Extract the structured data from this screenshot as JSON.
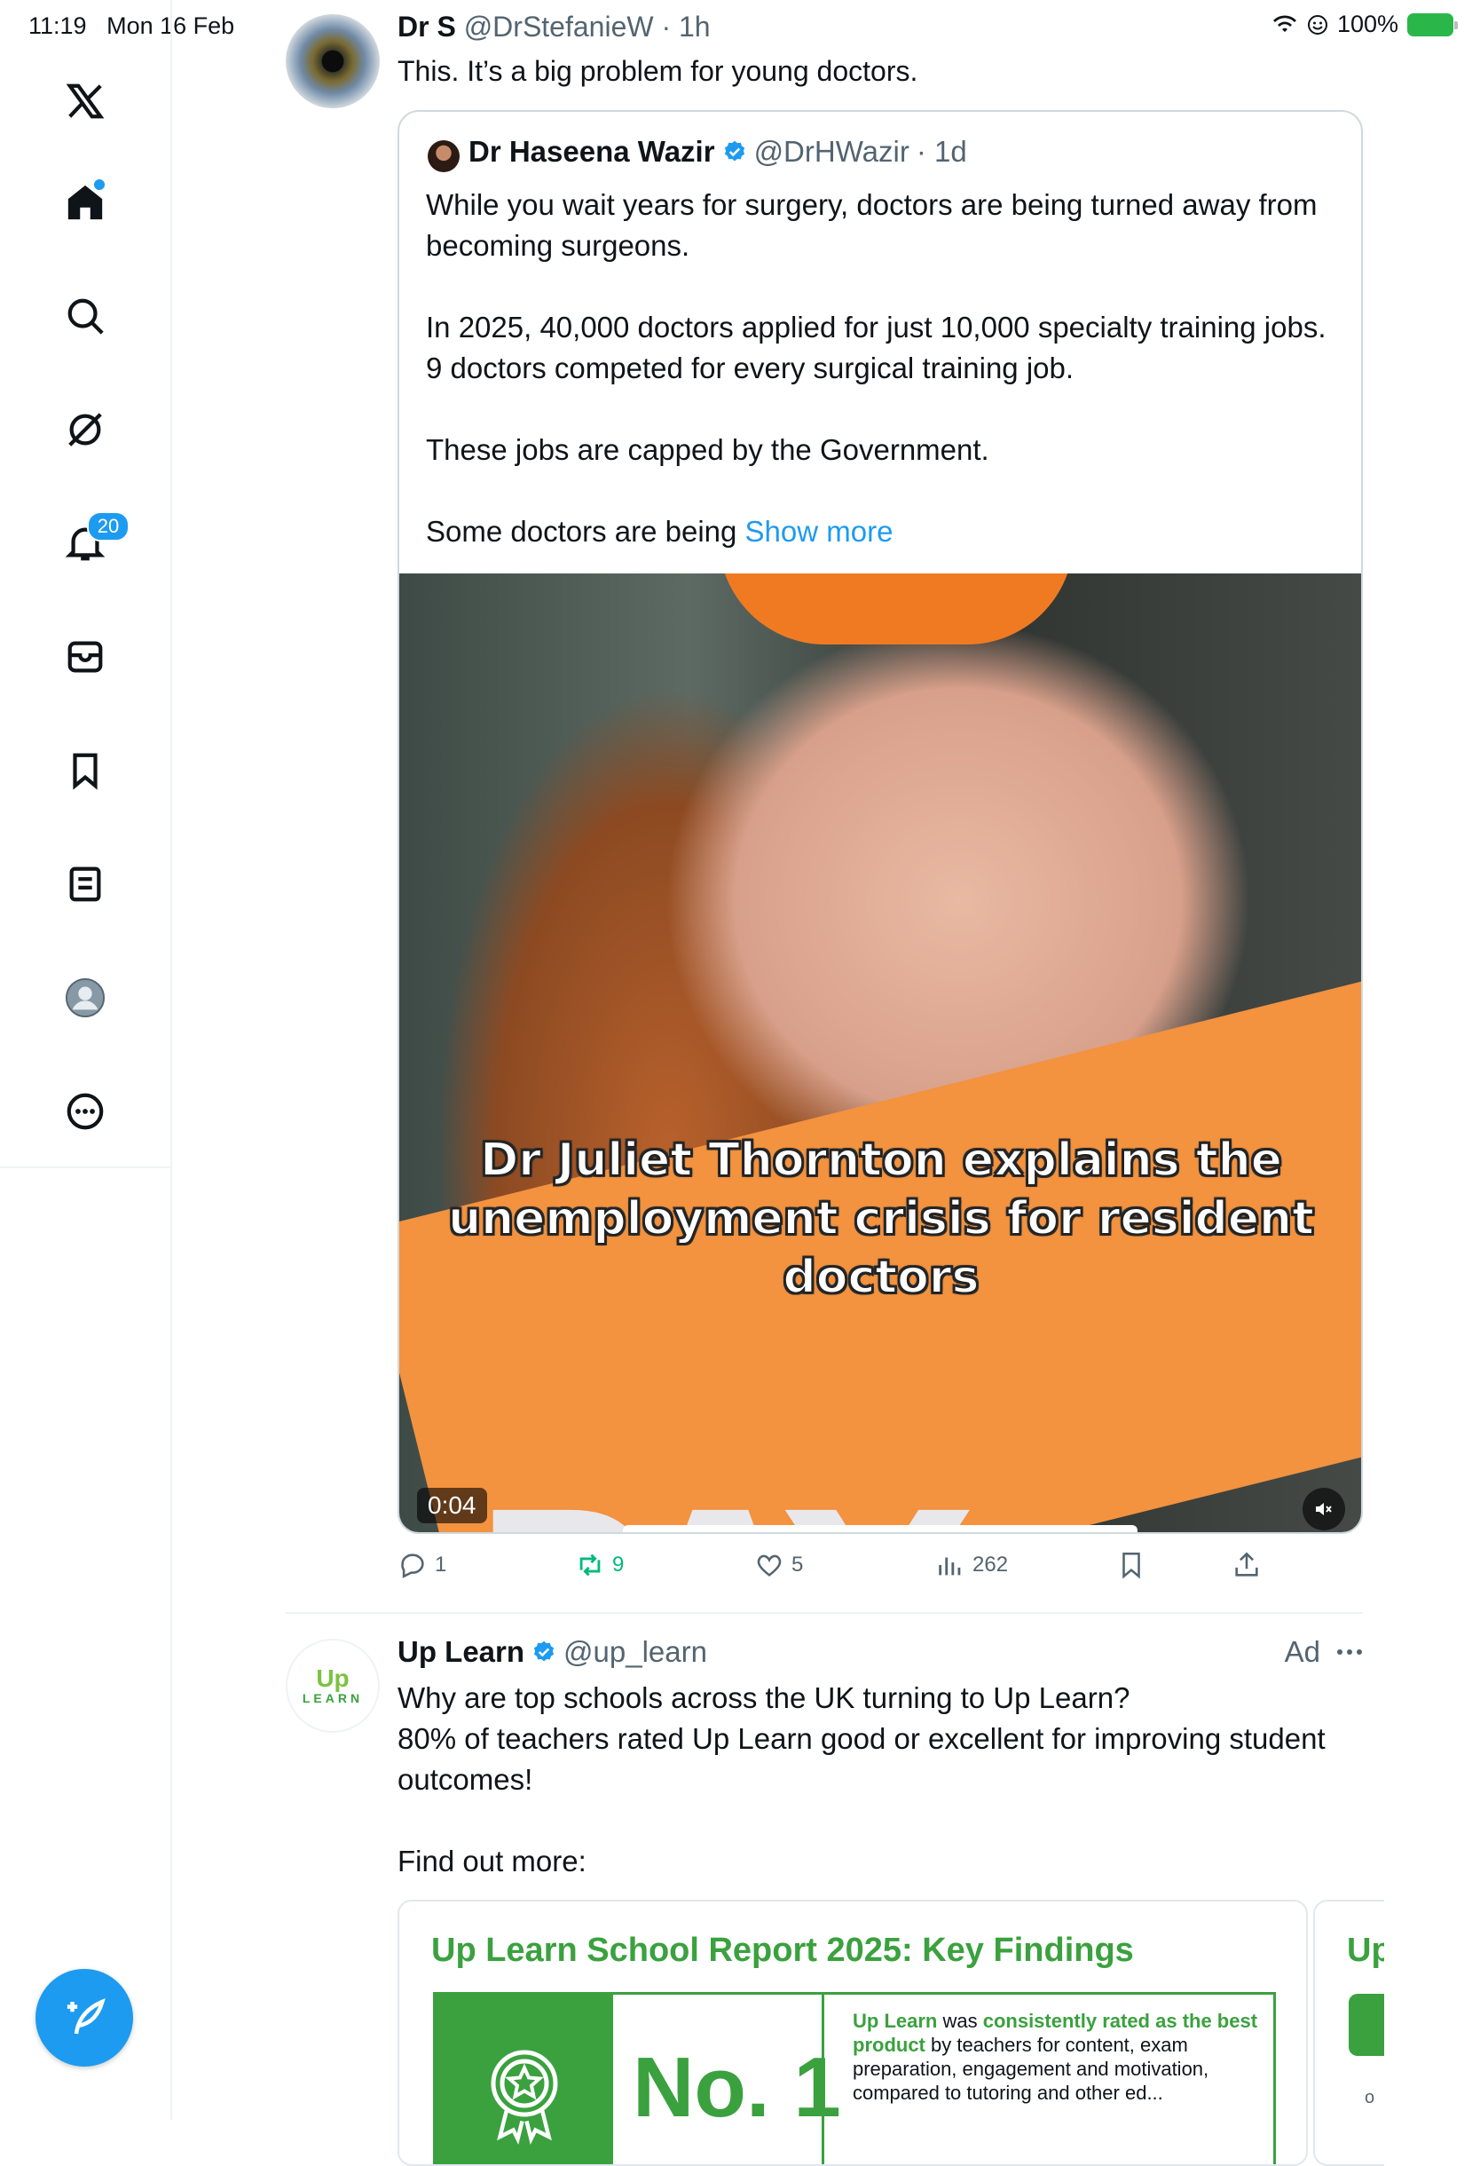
{
  "status_bar": {
    "time": "11:19",
    "date": "Mon 16 Feb",
    "battery": "100%"
  },
  "sidebar": {
    "items": [
      {
        "name": "x-logo"
      },
      {
        "name": "home"
      },
      {
        "name": "search"
      },
      {
        "name": "grok"
      },
      {
        "name": "notifications",
        "badge": "20"
      },
      {
        "name": "messages"
      },
      {
        "name": "bookmarks"
      },
      {
        "name": "lists"
      },
      {
        "name": "profile"
      },
      {
        "name": "more"
      }
    ]
  },
  "tweet": {
    "author_name": "Dr S",
    "author_handle": "@DrStefanieW",
    "time": "· 1h",
    "text": "This. It’s a big problem for young doctors.",
    "quote": {
      "author_name": "Dr Haseena Wazir",
      "author_handle": "@DrHWazir",
      "time": "· 1d",
      "p1": "While you wait years for surgery, doctors are being turned away from becoming surgeons.",
      "p2": "In 2025, 40,000 doctors applied for just 10,000 specialty training jobs. 9 doctors competed for every surgical training job.",
      "p3": "These jobs are capped by the Government.",
      "p4": "Some doctors are being",
      "show_more": "Show more",
      "video": {
        "caption": "Dr Juliet Thornton explains the unemployment crisis for resident doctors",
        "sign_text": "PAY",
        "duration": "0:04"
      }
    },
    "actions": {
      "replies": "1",
      "reposts": "9",
      "likes": "5",
      "views": "262"
    }
  },
  "ad": {
    "author_name": "Up Learn",
    "author_handle": "@up_learn",
    "label": "Ad",
    "logo_top": "Up",
    "logo_bottom": "LEARN",
    "line1": "Why are top schools across the UK turning to Up Learn?",
    "line2": "80% of teachers rated Up Learn good or excellent for improving student outcomes!",
    "line3": "Find out more:",
    "card": {
      "title": "Up Learn School Report 2025: Key Findings",
      "big": "No. 1",
      "desc_a": "Up Learn",
      "desc_b": " was ",
      "desc_c": "consistently rated as the best product",
      "desc_d": " by teachers for content, exam preparation, engagement and motivation, compared to tutoring and other ed...",
      "card2_title": "Up",
      "card2_small": "o"
    }
  },
  "colors": {
    "accent": "#1d9bf0",
    "repost": "#00ba7c",
    "brand_green": "#3aa13e"
  }
}
